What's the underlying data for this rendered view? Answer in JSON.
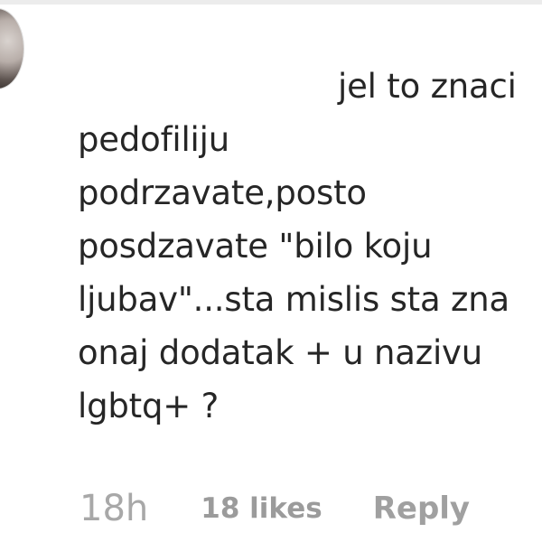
{
  "comment": {
    "lines": [
      "jel to znaci",
      "pedofiliju",
      "podrzavate,posto",
      "posdzavate \"bilo koju",
      "ljubav\"...sta mislis sta zna",
      "onaj dodatak + u nazivu",
      "lgbtq+ ?"
    ]
  },
  "meta": {
    "time": "18h",
    "likes": "18 likes",
    "reply": "Reply"
  },
  "icons": {
    "avatar": "profile-avatar"
  },
  "colors": {
    "text": "#262626",
    "muted": "#8e8e8e"
  }
}
